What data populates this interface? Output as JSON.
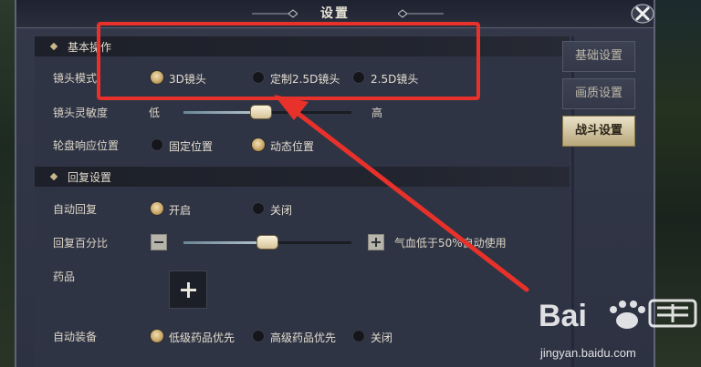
{
  "window": {
    "title": "设置"
  },
  "sections": {
    "basic": {
      "header": "基本操作"
    },
    "recovery": {
      "header": "回复设置"
    }
  },
  "camera_mode": {
    "label": "镜头模式",
    "options": [
      {
        "label": "3D镜头",
        "selected": true
      },
      {
        "label": "定制2.5D镜头",
        "selected": false
      },
      {
        "label": "2.5D镜头",
        "selected": false
      }
    ]
  },
  "camera_sensitivity": {
    "label": "镜头灵敏度",
    "min_label": "低",
    "max_label": "高",
    "value": 0.46
  },
  "wheel_position": {
    "label": "轮盘响应位置",
    "options": [
      {
        "label": "固定位置",
        "selected": false
      },
      {
        "label": "动态位置",
        "selected": true
      }
    ]
  },
  "auto_recover": {
    "label": "自动回复",
    "options": [
      {
        "label": "开启",
        "selected": true
      },
      {
        "label": "关闭",
        "selected": false
      }
    ]
  },
  "recover_percent": {
    "label": "回复百分比",
    "value": 0.5,
    "hint": "气血低于50%自动使用"
  },
  "medicine": {
    "label": "药品"
  },
  "auto_equip": {
    "label": "自动装备",
    "options": [
      {
        "label": "低级药品优先",
        "selected": true
      },
      {
        "label": "高级药品优先",
        "selected": false
      },
      {
        "label": "关闭",
        "selected": false
      }
    ]
  },
  "tabs": [
    {
      "label": "基础设置",
      "active": false
    },
    {
      "label": "画质设置",
      "active": false
    },
    {
      "label": "战斗设置",
      "active": true
    }
  ],
  "watermark": {
    "text": "jingyan.baidu.com"
  },
  "colors": {
    "annotation": "#e8312a",
    "accent": "#c9a86a"
  }
}
